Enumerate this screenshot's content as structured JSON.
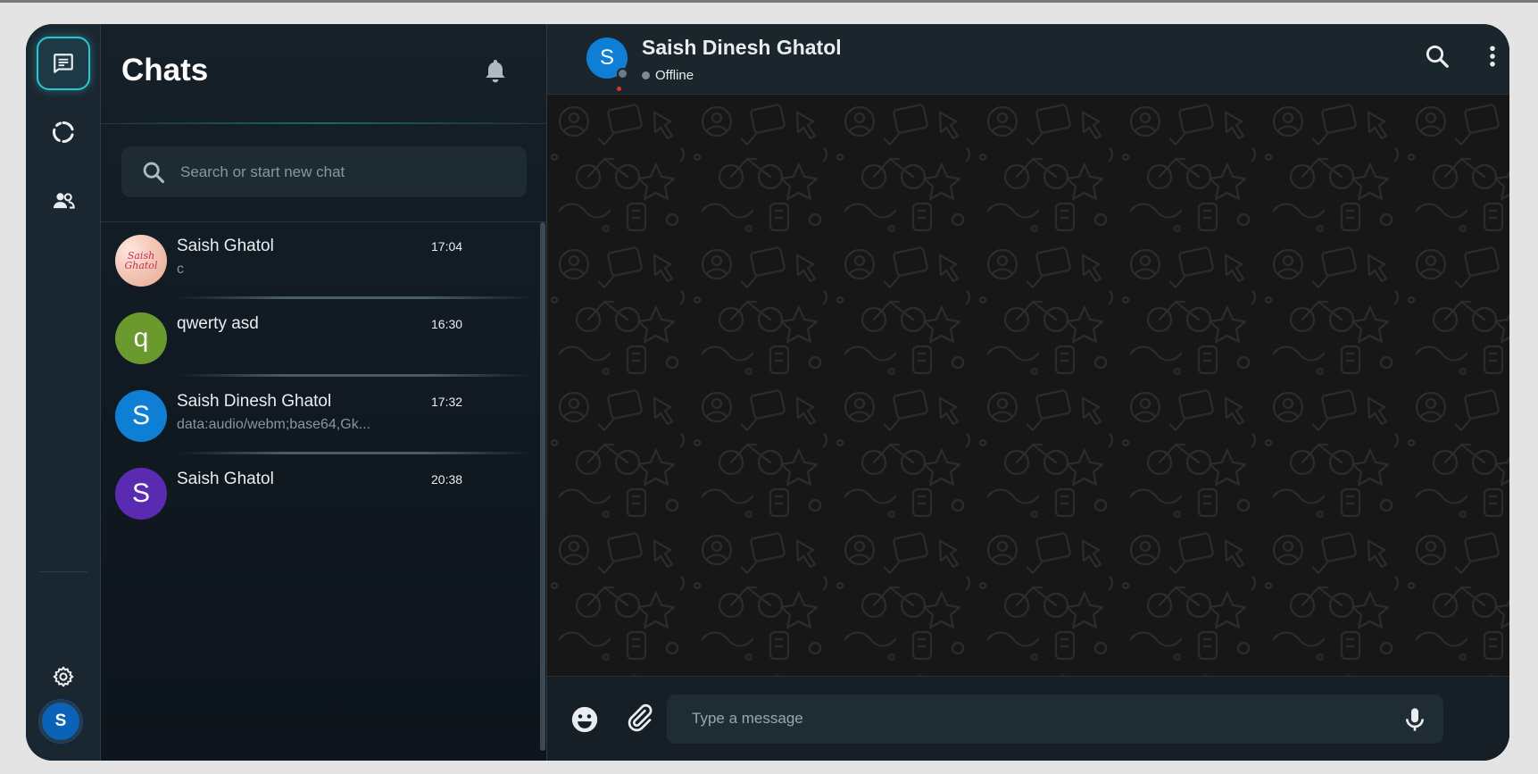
{
  "rail": {
    "items": [
      {
        "name": "chats",
        "icon": "chat-icon",
        "active": true
      },
      {
        "name": "status",
        "icon": "status-ring-icon",
        "active": false
      },
      {
        "name": "communities",
        "icon": "people-icon",
        "active": false
      }
    ],
    "settings_icon": "gear-icon",
    "profile_initial": "S"
  },
  "panel": {
    "title": "Chats",
    "search_placeholder": "Search or start new chat"
  },
  "chats": [
    {
      "name": "Saish Ghatol",
      "time": "17:04",
      "preview": "c",
      "avatar_text": "Saish Ghatol",
      "avatar_type": "image"
    },
    {
      "name": "qwerty asd",
      "time": "16:30",
      "preview": "",
      "avatar_text": "q",
      "avatar_color": "#6a9a2e"
    },
    {
      "name": "Saish Dinesh Ghatol",
      "time": "17:32",
      "preview": "data:audio/webm;base64,Gk...",
      "avatar_text": "S",
      "avatar_color": "#0e7fd4"
    },
    {
      "name": "Saish Ghatol",
      "time": "20:38",
      "preview": "",
      "avatar_text": "S",
      "avatar_color": "#5a2bb0"
    }
  ],
  "conversation": {
    "contact_name": "Saish Dinesh Ghatol",
    "contact_initial": "S",
    "status": "Offline"
  },
  "composer": {
    "placeholder": "Type a message"
  },
  "colors": {
    "accent": "#2ec4d4",
    "background": "#111b21",
    "panel": "#1b2730"
  }
}
